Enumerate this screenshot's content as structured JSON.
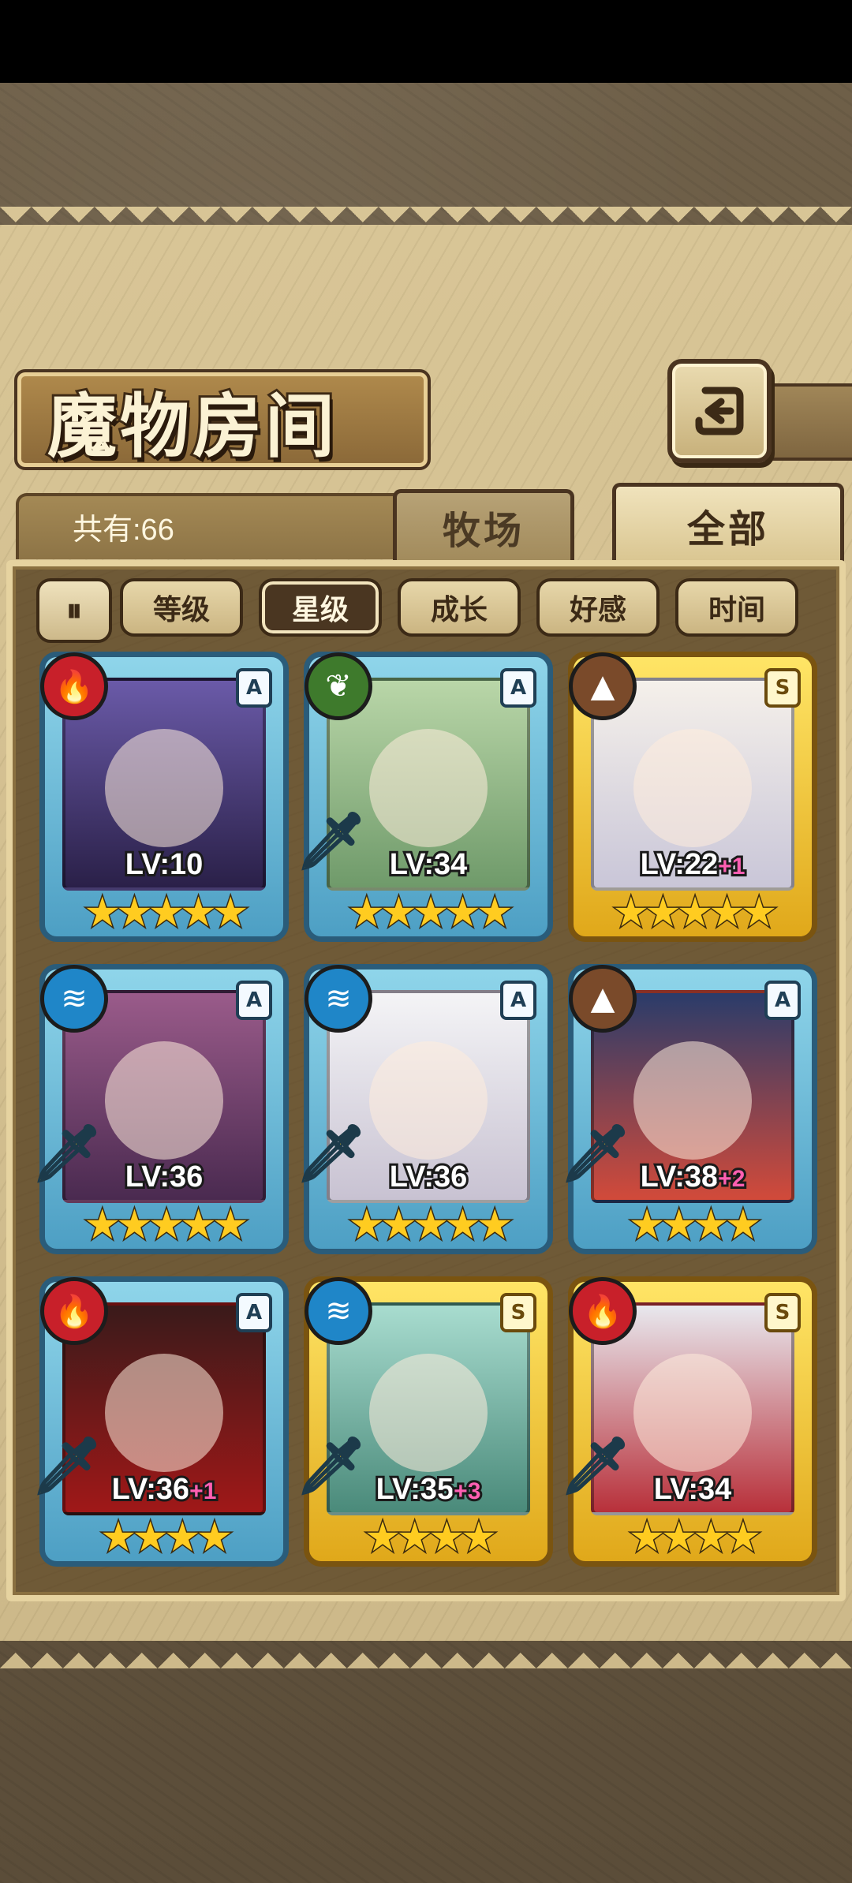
{
  "header": {
    "title": "魔物房间",
    "back_icon": "return-arrow-icon"
  },
  "summary": {
    "count_label": "共有:66"
  },
  "tabs": [
    {
      "label": "牧场",
      "active": false
    },
    {
      "label": "全部",
      "active": true
    }
  ],
  "filters": {
    "toggle_icon": "sort-order-icon",
    "items": [
      {
        "label": "等级",
        "active": false
      },
      {
        "label": "星级",
        "active": true
      },
      {
        "label": "成长",
        "active": false
      },
      {
        "label": "好感",
        "active": false
      },
      {
        "label": "时间",
        "active": false
      }
    ]
  },
  "monsters": [
    {
      "element": "fire",
      "rank": "A",
      "level": "LV:10",
      "bonus": "",
      "stars": 5,
      "weapon": false
    },
    {
      "element": "wood",
      "rank": "A",
      "level": "LV:34",
      "bonus": "",
      "stars": 5,
      "weapon": true
    },
    {
      "element": "earth",
      "rank": "S",
      "level": "LV:22",
      "bonus": "+1",
      "stars": 5,
      "weapon": false
    },
    {
      "element": "water",
      "rank": "A",
      "level": "LV:36",
      "bonus": "",
      "stars": 5,
      "weapon": true
    },
    {
      "element": "water",
      "rank": "A",
      "level": "LV:36",
      "bonus": "",
      "stars": 5,
      "weapon": true
    },
    {
      "element": "earth",
      "rank": "A",
      "level": "LV:38",
      "bonus": "+2",
      "stars": 4,
      "weapon": true
    },
    {
      "element": "fire",
      "rank": "A",
      "level": "LV:36",
      "bonus": "+1",
      "stars": 4,
      "weapon": true
    },
    {
      "element": "water",
      "rank": "S",
      "level": "LV:35",
      "bonus": "+3",
      "stars": 4,
      "weapon": true
    },
    {
      "element": "fire",
      "rank": "S",
      "level": "LV:34",
      "bonus": "",
      "stars": 4,
      "weapon": true
    }
  ]
}
